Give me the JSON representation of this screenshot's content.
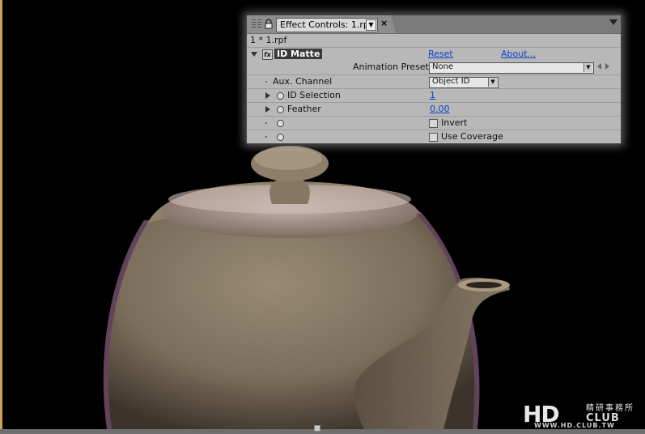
{
  "panel": {
    "tab_label": "Effect Controls: 1.rpf",
    "close_glyph": "×",
    "layer_label": "1 * 1.rpf"
  },
  "effect": {
    "name": "ID Matte",
    "fx_glyph": "fx",
    "reset_label": "Reset",
    "about_label": "About...",
    "presets_label": "Animation Presets:",
    "presets_value": "None"
  },
  "params": {
    "aux_channel": {
      "label": "Aux. Channel",
      "value": "Object ID"
    },
    "id_selection": {
      "label": "ID Selection",
      "value": "1"
    },
    "feather": {
      "label": "Feather",
      "value": "0.00"
    },
    "invert": {
      "label": "Invert",
      "checked": false
    },
    "use_coverage": {
      "label": "Use Coverage",
      "checked": false
    }
  },
  "watermark": {
    "logo_text": "HD",
    "logo_suffix": "CLUB",
    "chinese_text": "精研事務所",
    "url": "WWW.HD.CLUB.TW"
  },
  "colors": {
    "panel_bg": "#b8b8b8",
    "link": "#1040d0",
    "teapot": "#8a7c68",
    "rim_light": "#c98ab8",
    "frame": "#c9a64a"
  },
  "icons": {
    "lock": "lock-icon",
    "dropdown": "chevron-down-icon",
    "twirl_open": "triangle-down-icon",
    "twirl_closed": "triangle-right-icon",
    "stopwatch": "stopwatch-icon"
  }
}
